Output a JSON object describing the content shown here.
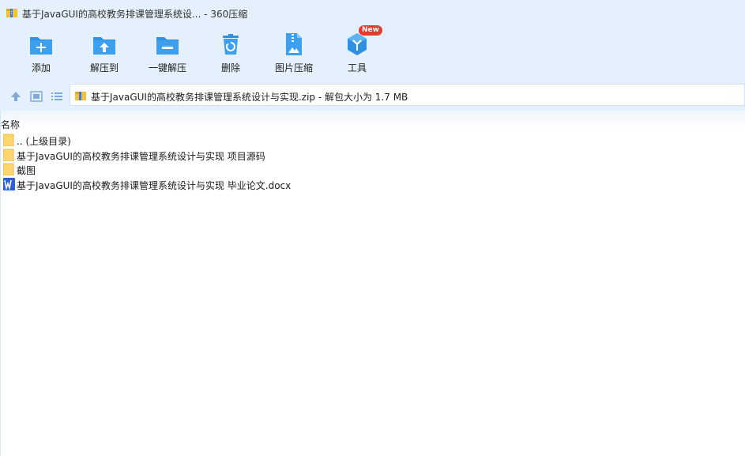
{
  "window": {
    "title": "基于JavaGUI的高校教务排课管理系统设... - 360压缩"
  },
  "toolbar": {
    "items": [
      {
        "label": "添加",
        "icon": "add-folder-icon"
      },
      {
        "label": "解压到",
        "icon": "extract-to-icon"
      },
      {
        "label": "一键解压",
        "icon": "one-click-extract-icon"
      },
      {
        "label": "删除",
        "icon": "recycle-bin-icon"
      },
      {
        "label": "图片压缩",
        "icon": "image-compress-icon"
      },
      {
        "label": "工具",
        "icon": "tools-icon"
      }
    ],
    "new_badge": "New"
  },
  "nav": {
    "address": "基于JavaGUI的高校教务排课管理系统设计与实现.zip - 解包大小为 1.7 MB"
  },
  "list": {
    "column_name": "名称",
    "rows": [
      {
        "name": ".. (上级目录)",
        "type": "folder"
      },
      {
        "name": "基于JavaGUI的高校教务排课管理系统设计与实现 项目源码",
        "type": "folder"
      },
      {
        "name": "截图",
        "type": "folder"
      },
      {
        "name": "基于JavaGUI的高校教务排课管理系统设计与实现 毕业论文.docx",
        "type": "word"
      }
    ]
  },
  "colors": {
    "accent": "#2f8fe0",
    "bar_bg": "#e4f0fb",
    "badge": "#e8392f"
  }
}
